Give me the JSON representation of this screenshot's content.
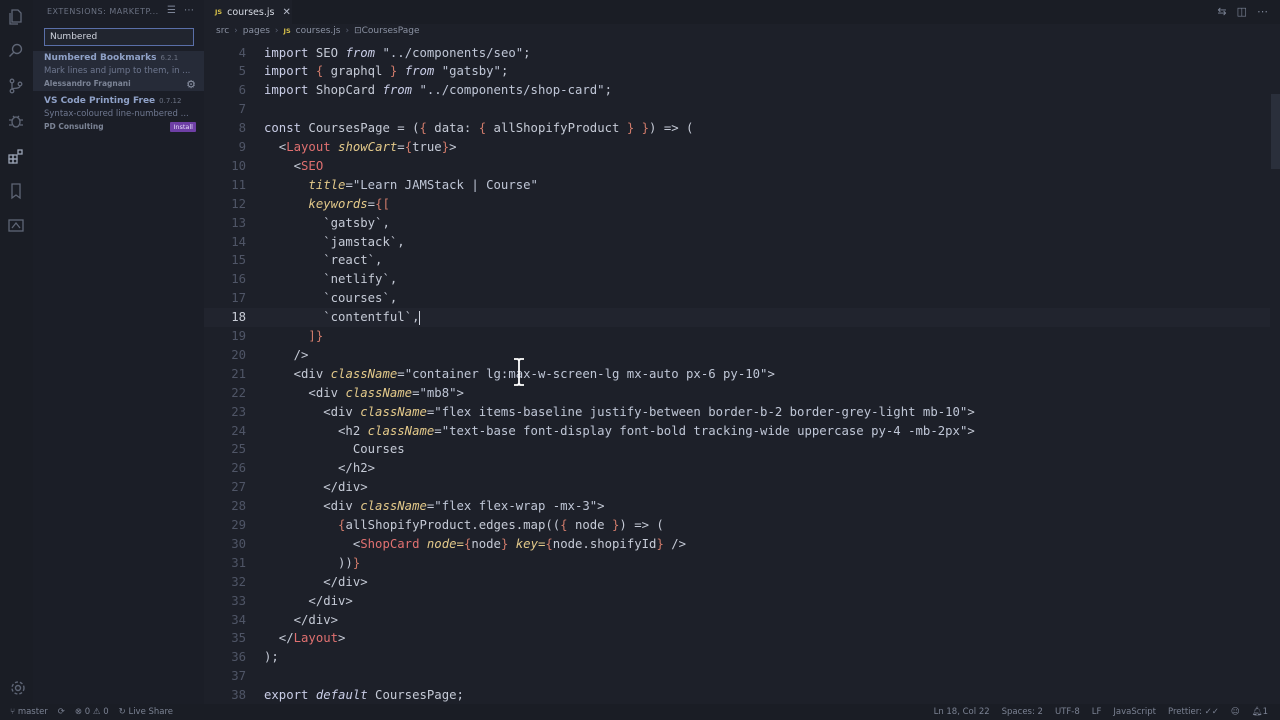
{
  "sidebar": {
    "title": "EXTENSIONS: MARKETP...",
    "search_value": "Numbered",
    "extensions": [
      {
        "name": "Numbered Bookmarks",
        "version": "6.2.1",
        "description": "Mark lines and jump to them, in ...",
        "publisher": "Alessandro Fragnani",
        "action_icon": "gear-icon"
      },
      {
        "name": "VS Code Printing Free",
        "version": "0.7.12",
        "description": "Syntax-coloured line-numbered ...",
        "publisher": "PD Consulting",
        "action_label": "Install"
      }
    ]
  },
  "tab": {
    "file_type": "JS",
    "label": "courses.js"
  },
  "breadcrumb": [
    "src",
    "pages",
    "courses.js",
    "CoursesPage"
  ],
  "breadcrumb_symbol": "⊡",
  "editor": {
    "current_line": 18,
    "lines": [
      {
        "n": "4",
        "t": "import SEO from \"../components/seo\";"
      },
      {
        "n": "5",
        "t": "import { graphql } from \"gatsby\";"
      },
      {
        "n": "6",
        "t": "import ShopCard from \"../components/shop-card\";"
      },
      {
        "n": "7",
        "t": ""
      },
      {
        "n": "8",
        "t": "const CoursesPage = ({ data: { allShopifyProduct } }) => ("
      },
      {
        "n": "9",
        "t": "  <Layout showCart={true}>"
      },
      {
        "n": "10",
        "t": "    <SEO"
      },
      {
        "n": "11",
        "t": "      title=\"Learn JAMStack | Course\""
      },
      {
        "n": "12",
        "t": "      keywords={["
      },
      {
        "n": "13",
        "t": "        `gatsby`,"
      },
      {
        "n": "14",
        "t": "        `jamstack`,"
      },
      {
        "n": "15",
        "t": "        `react`,"
      },
      {
        "n": "16",
        "t": "        `netlify`,"
      },
      {
        "n": "17",
        "t": "        `courses`,"
      },
      {
        "n": "18",
        "t": "        `contentful`,"
      },
      {
        "n": "19",
        "t": "      ]}"
      },
      {
        "n": "20",
        "t": "    />"
      },
      {
        "n": "21",
        "t": "    <div className=\"container lg:max-w-screen-lg mx-auto px-6 py-10\">"
      },
      {
        "n": "22",
        "t": "      <div className=\"mb8\">"
      },
      {
        "n": "23",
        "t": "        <div className=\"flex items-baseline justify-between border-b-2 border-grey-light mb-10\">"
      },
      {
        "n": "24",
        "t": "          <h2 className=\"text-base font-display font-bold tracking-wide uppercase py-4 -mb-2px\">"
      },
      {
        "n": "25",
        "t": "            Courses"
      },
      {
        "n": "26",
        "t": "          </h2>"
      },
      {
        "n": "27",
        "t": "        </div>"
      },
      {
        "n": "28",
        "t": "        <div className=\"flex flex-wrap -mx-3\">"
      },
      {
        "n": "29",
        "t": "          {allShopifyProduct.edges.map(({ node }) => ("
      },
      {
        "n": "30",
        "t": "            <ShopCard node={node} key={node.shopifyId} />"
      },
      {
        "n": "31",
        "t": "          ))}"
      },
      {
        "n": "32",
        "t": "        </div>"
      },
      {
        "n": "33",
        "t": "      </div>"
      },
      {
        "n": "34",
        "t": "    </div>"
      },
      {
        "n": "35",
        "t": "  </Layout>"
      },
      {
        "n": "36",
        "t": ");"
      },
      {
        "n": "37",
        "t": ""
      },
      {
        "n": "38",
        "t": "export default CoursesPage;"
      }
    ]
  },
  "statusbar": {
    "branch": "master",
    "errors": "0",
    "warnings": "0",
    "live_share": "Live Share",
    "position": "Ln 18, Col 22",
    "spaces": "Spaces: 2",
    "encoding": "UTF-8",
    "eol": "LF",
    "language": "JavaScript",
    "formatter": "Prettier: ✓✓",
    "notifications": "1"
  }
}
